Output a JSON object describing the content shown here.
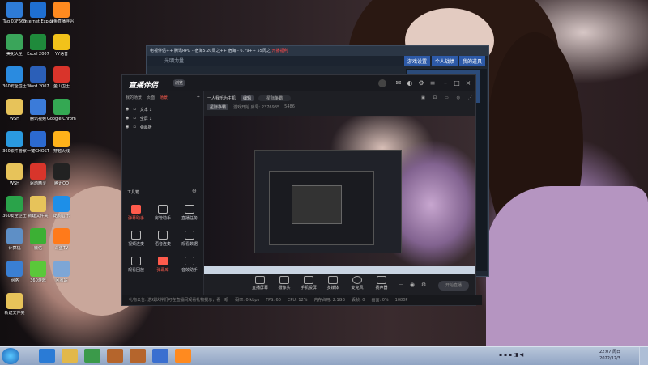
{
  "desktop": {
    "icons": [
      {
        "label": "Tag 03F665",
        "color": "#2e7bd6"
      },
      {
        "label": "Internet Explorer",
        "color": "#1f6fd1"
      },
      {
        "label": "斗鱼直播伴侣",
        "color": "#ff8a1f"
      },
      {
        "label": "美化大全",
        "color": "#3aa55a"
      },
      {
        "label": "Excel 2007",
        "color": "#1f8a3b"
      },
      {
        "label": "YY语音",
        "color": "#f2c21a"
      },
      {
        "label": "360安全卫士",
        "color": "#2a8be0"
      },
      {
        "label": "Word 2007",
        "color": "#2b5fb8"
      },
      {
        "label": "金山卫士",
        "color": "#d9342b"
      },
      {
        "label": "WSH",
        "color": "#e7c35a"
      },
      {
        "label": "腾讯视频",
        "color": "#3b7bd9"
      },
      {
        "label": "Google Chrome",
        "color": "#34a853"
      },
      {
        "label": "360软件管家",
        "color": "#2a9ae0"
      },
      {
        "label": "一键GHOST",
        "color": "#2c6ad0"
      },
      {
        "label": "穿越火线",
        "color": "#ffb21a"
      },
      {
        "label": "WSH",
        "color": "#e7c35a"
      },
      {
        "label": "驱动精灵",
        "color": "#d8352b"
      },
      {
        "label": "腾讯QQ",
        "color": "#222222"
      },
      {
        "label": "360安全卫士",
        "color": "#2aa34a"
      },
      {
        "label": "新建文件夹",
        "color": "#e7c35a"
      },
      {
        "label": "酷狗音乐",
        "color": "#1d8fe8"
      },
      {
        "label": "计算机",
        "color": "#5e8fc6"
      },
      {
        "label": "微信",
        "color": "#3cb034"
      },
      {
        "label": "斗鱼TV",
        "color": "#ff7a1a"
      },
      {
        "label": "网络",
        "color": "#3a7fd3"
      },
      {
        "label": "360游戏",
        "color": "#5ac83a"
      },
      {
        "label": "回收站",
        "color": "#7da6d6"
      },
      {
        "label": "新建文件夹",
        "color": "#e7c35a"
      }
    ]
  },
  "backwindow": {
    "title": "电视伴侣++ 腾讯RPG - 宿海5.20周之++ 宿海 - 6.79++ 55周之",
    "title_red": "开播福利",
    "tab": "光明力量",
    "tabs_right": [
      "游戏设置",
      "个人战绩",
      "我的道具"
    ]
  },
  "app": {
    "logo": "直播伴侣",
    "version": "浏览",
    "left_tabs": [
      "我的场景",
      "页面",
      "场景"
    ],
    "left_tab_active": "场景",
    "sources": [
      {
        "name": "文本 1"
      },
      {
        "name": "全屏 1"
      },
      {
        "name": "弹幕板"
      }
    ],
    "tools_title": "工具箱",
    "tools": [
      {
        "label": "弹幕助手",
        "active": true
      },
      {
        "label": "房管助手",
        "active": false
      },
      {
        "label": "直播任务",
        "active": false
      },
      {
        "label": "视频连麦",
        "active": false
      },
      {
        "label": "语音连麦",
        "active": false
      },
      {
        "label": "观看数据",
        "active": false
      },
      {
        "label": "观看回放",
        "active": false
      },
      {
        "label": "弹幕库",
        "active": true
      },
      {
        "label": "音效助手",
        "active": false
      }
    ],
    "header": {
      "title": "一人我乐为主机",
      "tag": "编辑",
      "pill": "星际争霸"
    },
    "subheader": {
      "tag": "星际争霸",
      "meta": "游戏开始",
      "room": "游戏开始 房号: 2376985",
      "viewers": "5486"
    },
    "controls": [
      {
        "label": "直播屏幕"
      },
      {
        "label": "摄像头"
      },
      {
        "label": "手机投屏"
      },
      {
        "label": "多媒体"
      },
      {
        "label": "麦克风"
      },
      {
        "label": "扬声器"
      }
    ],
    "live_button": "开始直播",
    "status": {
      "notice": "礼物公告: 游戏伙伴们可在直播间观看礼物提示，看一眼",
      "items": [
        "码率: 0 kbps",
        "FPS: 60",
        "CPU: 12%",
        "内存占用: 2.1GB",
        "丢帧: 0",
        "画面: 0%",
        "1080P"
      ]
    }
  },
  "taskbar": {
    "apps": [
      "Internet Explorer",
      "文件夹",
      "媒体播放器",
      "斗鱼",
      "斗鱼",
      "直播伴侣",
      "斗鱼直播伴侣"
    ],
    "clock_time": "22:07 周日",
    "clock_date": "2022/12/3"
  }
}
